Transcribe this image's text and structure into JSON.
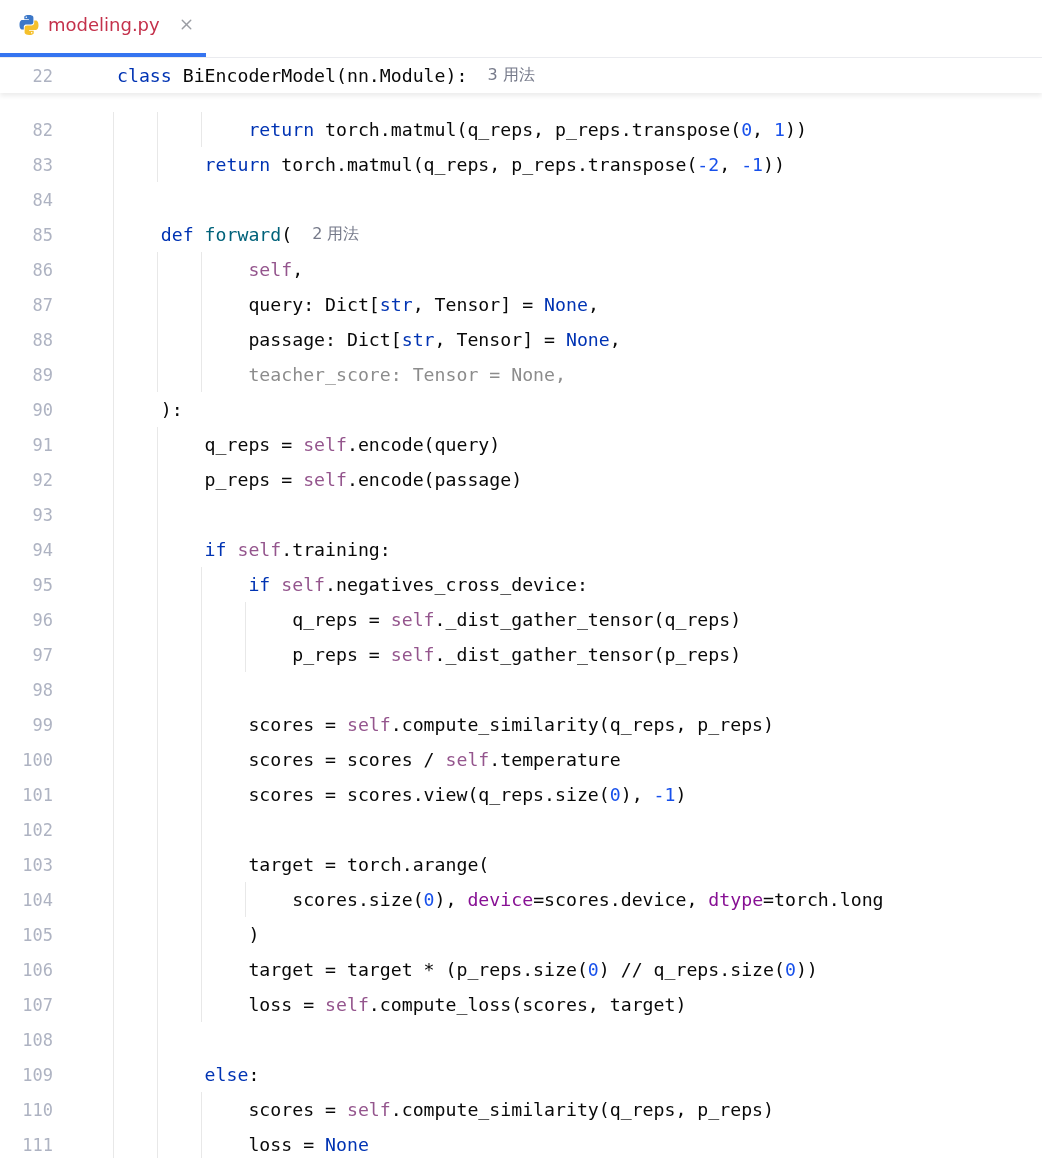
{
  "tab": {
    "label": "modeling.py",
    "selected": true
  },
  "sticky_line": {
    "number": "22",
    "tokens": [
      {
        "kind": "keyword",
        "text": "class"
      },
      {
        "kind": "plain",
        "text": " BiEncoderModel(nn.Module):"
      }
    ],
    "hint": "3 用法"
  },
  "lines": [
    {
      "number": "82",
      "tokens": [
        {
          "kind": "keyword",
          "text": "            return"
        },
        {
          "kind": "plain",
          "text": " torch.matmul(q_reps, p_reps.transpose("
        },
        {
          "kind": "number",
          "text": "0"
        },
        {
          "kind": "plain",
          "text": ", "
        },
        {
          "kind": "number",
          "text": "1"
        },
        {
          "kind": "plain",
          "text": "))"
        }
      ]
    },
    {
      "number": "83",
      "tokens": [
        {
          "kind": "keyword",
          "text": "        return"
        },
        {
          "kind": "plain",
          "text": " torch.matmul(q_reps, p_reps.transpose("
        },
        {
          "kind": "number",
          "text": "-2"
        },
        {
          "kind": "plain",
          "text": ", "
        },
        {
          "kind": "number",
          "text": "-1"
        },
        {
          "kind": "plain",
          "text": "))"
        }
      ]
    },
    {
      "number": "84"
    },
    {
      "number": "85",
      "tokens": [
        {
          "kind": "keyword",
          "text": "    def"
        },
        {
          "kind": "function",
          "text": " forward"
        },
        {
          "kind": "plain",
          "text": "("
        }
      ],
      "hint": "2 用法"
    },
    {
      "number": "86",
      "tokens": [
        {
          "kind": "self",
          "text": "            self"
        },
        {
          "kind": "plain",
          "text": ","
        }
      ]
    },
    {
      "number": "87",
      "tokens": [
        {
          "kind": "plain",
          "text": "            query: Dict["
        },
        {
          "kind": "keyword",
          "text": "str"
        },
        {
          "kind": "plain",
          "text": ", Tensor] = "
        },
        {
          "kind": "keyword",
          "text": "None"
        },
        {
          "kind": "plain",
          "text": ","
        }
      ]
    },
    {
      "number": "88",
      "tokens": [
        {
          "kind": "plain",
          "text": "            passage: Dict["
        },
        {
          "kind": "keyword",
          "text": "str"
        },
        {
          "kind": "plain",
          "text": ", Tensor] = "
        },
        {
          "kind": "keyword",
          "text": "None"
        },
        {
          "kind": "plain",
          "text": ","
        }
      ]
    },
    {
      "number": "89",
      "tokens": [
        {
          "kind": "unused",
          "text": "            teacher_score: Tensor = None,"
        }
      ]
    },
    {
      "number": "90",
      "tokens": [
        {
          "kind": "plain",
          "text": "    ):"
        }
      ]
    },
    {
      "number": "91",
      "tokens": [
        {
          "kind": "plain",
          "text": "        q_reps = "
        },
        {
          "kind": "self",
          "text": "self"
        },
        {
          "kind": "plain",
          "text": ".encode(query)"
        }
      ]
    },
    {
      "number": "92",
      "tokens": [
        {
          "kind": "plain",
          "text": "        p_reps = "
        },
        {
          "kind": "self",
          "text": "self"
        },
        {
          "kind": "plain",
          "text": ".encode(passage)"
        }
      ]
    },
    {
      "number": "93"
    },
    {
      "number": "94",
      "tokens": [
        {
          "kind": "keyword",
          "text": "        if"
        },
        {
          "kind": "self",
          "text": " self"
        },
        {
          "kind": "plain",
          "text": ".training:"
        }
      ]
    },
    {
      "number": "95",
      "tokens": [
        {
          "kind": "keyword",
          "text": "            if"
        },
        {
          "kind": "self",
          "text": " self"
        },
        {
          "kind": "plain",
          "text": ".negatives_cross_device:"
        }
      ]
    },
    {
      "number": "96",
      "tokens": [
        {
          "kind": "plain",
          "text": "                q_reps = "
        },
        {
          "kind": "self",
          "text": "self"
        },
        {
          "kind": "plain",
          "text": "._dist_gather_tensor(q_reps)"
        }
      ]
    },
    {
      "number": "97",
      "tokens": [
        {
          "kind": "plain",
          "text": "                p_reps = "
        },
        {
          "kind": "self",
          "text": "self"
        },
        {
          "kind": "plain",
          "text": "._dist_gather_tensor(p_reps)"
        }
      ]
    },
    {
      "number": "98"
    },
    {
      "number": "99",
      "tokens": [
        {
          "kind": "plain",
          "text": "            scores = "
        },
        {
          "kind": "self",
          "text": "self"
        },
        {
          "kind": "plain",
          "text": ".compute_similarity(q_reps, p_reps)"
        }
      ]
    },
    {
      "number": "100",
      "tokens": [
        {
          "kind": "plain",
          "text": "            scores = scores / "
        },
        {
          "kind": "self",
          "text": "self"
        },
        {
          "kind": "plain",
          "text": ".temperature"
        }
      ]
    },
    {
      "number": "101",
      "tokens": [
        {
          "kind": "plain",
          "text": "            scores = scores.view(q_reps.size("
        },
        {
          "kind": "number",
          "text": "0"
        },
        {
          "kind": "plain",
          "text": "), "
        },
        {
          "kind": "number",
          "text": "-1"
        },
        {
          "kind": "plain",
          "text": ")"
        }
      ]
    },
    {
      "number": "102"
    },
    {
      "number": "103",
      "tokens": [
        {
          "kind": "plain",
          "text": "            target = torch.arange("
        }
      ]
    },
    {
      "number": "104",
      "tokens": [
        {
          "kind": "plain",
          "text": "                scores.size("
        },
        {
          "kind": "number",
          "text": "0"
        },
        {
          "kind": "plain",
          "text": "), "
        },
        {
          "kind": "kwarg",
          "text": "device"
        },
        {
          "kind": "plain",
          "text": "=scores.device, "
        },
        {
          "kind": "kwarg",
          "text": "dtype"
        },
        {
          "kind": "plain",
          "text": "=torch.long"
        }
      ]
    },
    {
      "number": "105",
      "tokens": [
        {
          "kind": "plain",
          "text": "            )"
        }
      ]
    },
    {
      "number": "106",
      "tokens": [
        {
          "kind": "plain",
          "text": "            target = target * (p_reps.size("
        },
        {
          "kind": "number",
          "text": "0"
        },
        {
          "kind": "plain",
          "text": ") // q_reps.size("
        },
        {
          "kind": "number",
          "text": "0"
        },
        {
          "kind": "plain",
          "text": "))"
        }
      ]
    },
    {
      "number": "107",
      "tokens": [
        {
          "kind": "plain",
          "text": "            loss = "
        },
        {
          "kind": "self",
          "text": "self"
        },
        {
          "kind": "plain",
          "text": ".compute_loss(scores, target)"
        }
      ]
    },
    {
      "number": "108"
    },
    {
      "number": "109",
      "tokens": [
        {
          "kind": "keyword",
          "text": "        else"
        },
        {
          "kind": "plain",
          "text": ":"
        }
      ]
    },
    {
      "number": "110",
      "tokens": [
        {
          "kind": "plain",
          "text": "            scores = "
        },
        {
          "kind": "self",
          "text": "self"
        },
        {
          "kind": "plain",
          "text": ".compute_similarity(q_reps, p_reps)"
        }
      ]
    },
    {
      "number": "111",
      "tokens": [
        {
          "kind": "plain",
          "text": "            loss = "
        },
        {
          "kind": "keyword",
          "text": "None"
        }
      ]
    }
  ]
}
